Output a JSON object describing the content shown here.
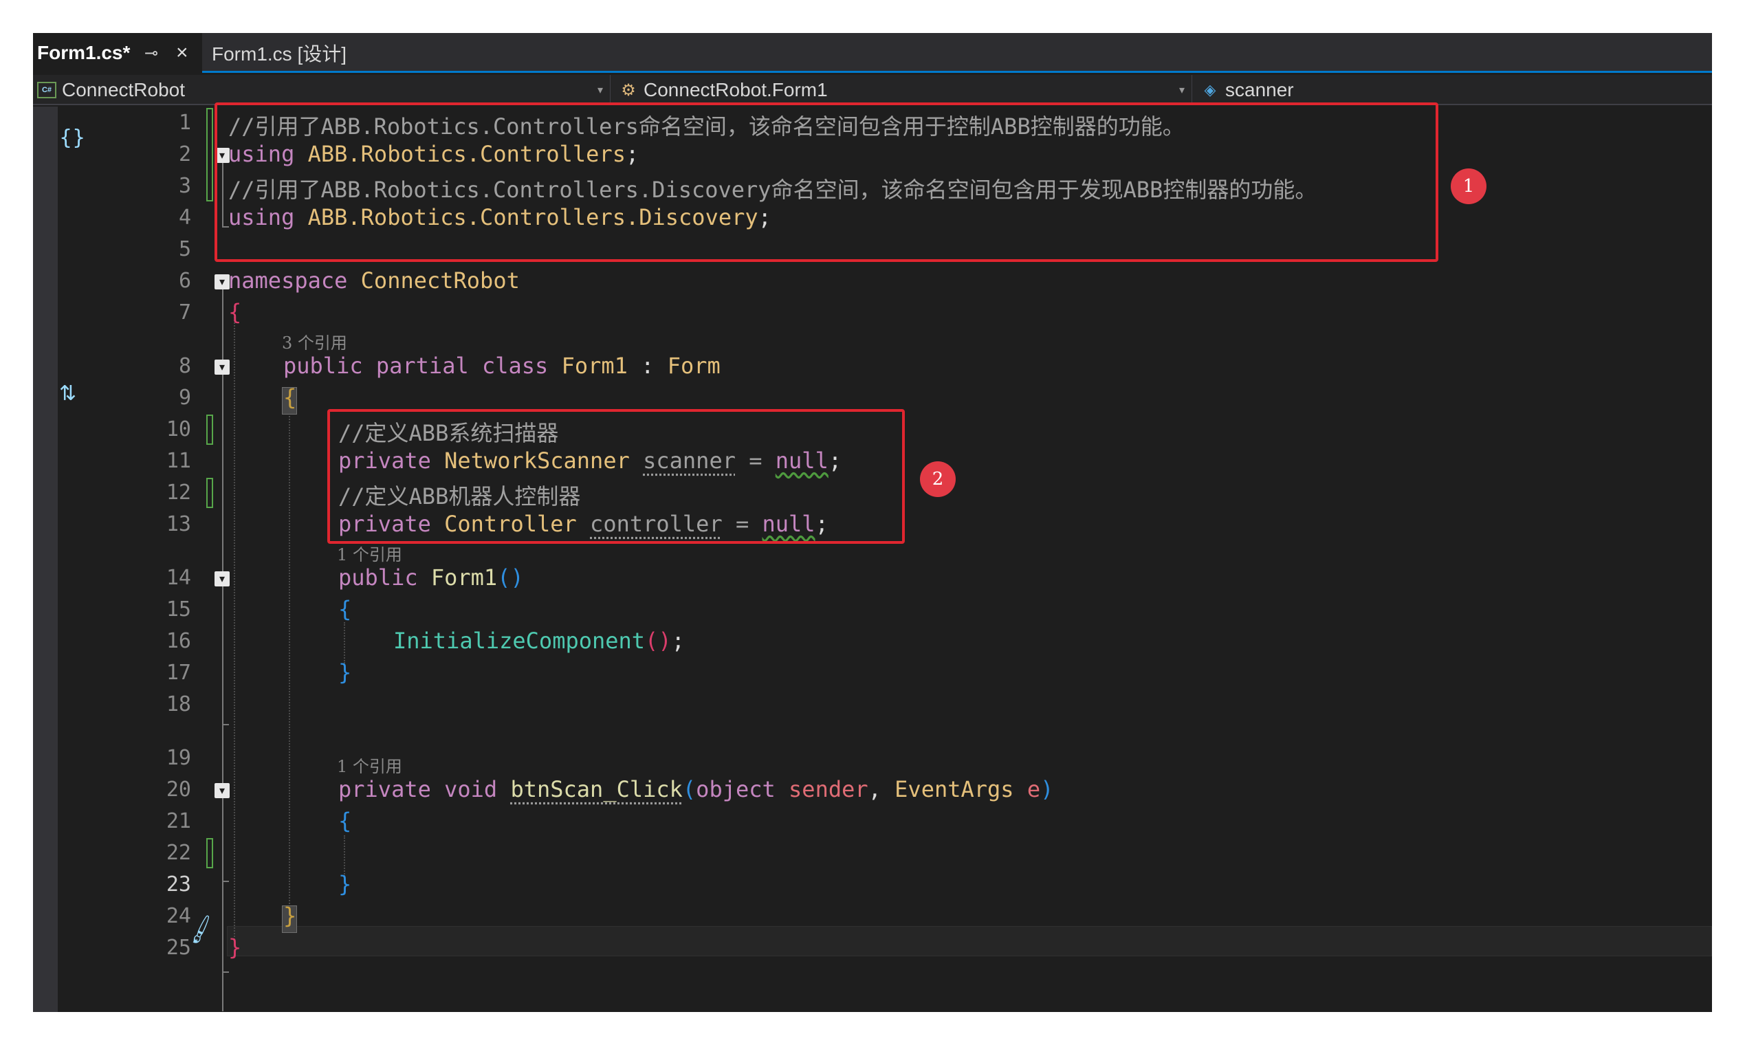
{
  "tabs": [
    {
      "label": "Form1.cs*",
      "active": true
    },
    {
      "label": "Form1.cs [设计]",
      "active": false
    }
  ],
  "tab_pin_icon": "pin-icon",
  "tab_close_icon": "close-icon",
  "navbar": {
    "project": "ConnectRobot",
    "type": "ConnectRobot.Form1",
    "member": "scanner"
  },
  "lines": {
    "l1": "//引用了ABB.Robotics.Controllers命名空间，该命名空间包含用于控制ABB控制器的功能。",
    "l2_kw": "using",
    "l2_ns": "ABB.Robotics.Controllers",
    "l3": "//引用了ABB.Robotics.Controllers.Discovery命名空间，该命名空间包含用于发现ABB控制器的功能。",
    "l4_kw": "using",
    "l4_ns": "ABB.Robotics.Controllers.Discovery",
    "l6_kw": "namespace",
    "l6_name": "ConnectRobot",
    "l8_lens": "3 个引用",
    "l8_kw": "public partial class",
    "l8_name": "Form1",
    "l8_base": "Form",
    "l10": "//定义ABB系统扫描器",
    "l11_kw": "private",
    "l11_type": "NetworkScanner",
    "l11_var": "scanner",
    "l11_null": "null",
    "l12": "//定义ABB机器人控制器",
    "l13_kw": "private",
    "l13_type": "Controller",
    "l13_var": "controller",
    "l13_null": "null",
    "l14_lens": "1 个引用",
    "l14_kw": "public",
    "l14_name": "Form1",
    "l16_call": "InitializeComponent",
    "l19_lens": "1 个引用",
    "l19_kw": "private void",
    "l19_name": "btnScan_Click",
    "l19_p1type": "object",
    "l19_p1": "sender",
    "l19_p2type": "EventArgs",
    "l19_p2": "e"
  },
  "line_numbers": [
    "1",
    "2",
    "3",
    "4",
    "5",
    "6",
    "7",
    "8",
    "9",
    "10",
    "11",
    "12",
    "13",
    "14",
    "15",
    "16",
    "17",
    "18",
    "19",
    "20",
    "21",
    "22",
    "23",
    "24",
    "25"
  ],
  "annotations": [
    "1",
    "2"
  ],
  "colors": {
    "annotation": "#e0262f",
    "badge": "#e23a45",
    "accent": "#007acc"
  }
}
